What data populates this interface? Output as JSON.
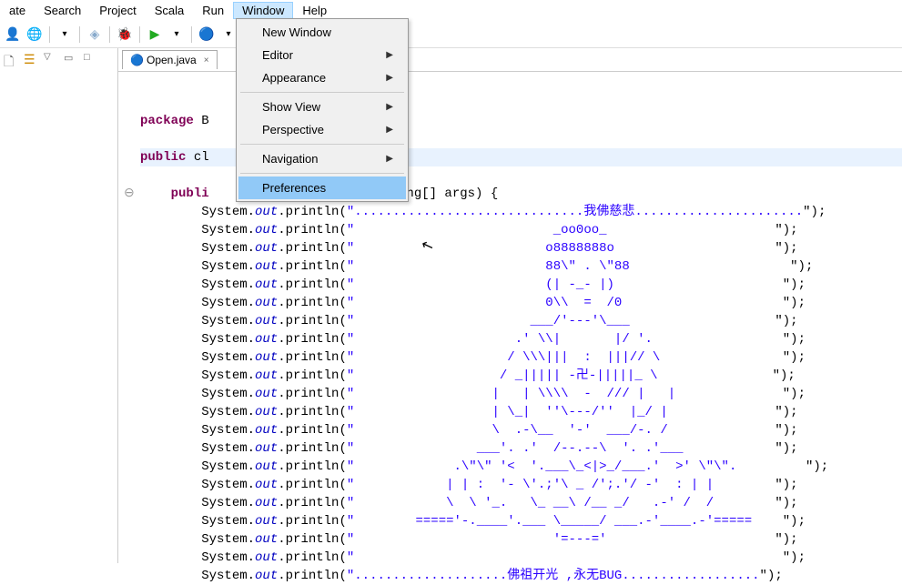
{
  "menubar": {
    "items": [
      "ate",
      "Search",
      "Project",
      "Scala",
      "Run",
      "Window",
      "Help"
    ],
    "active": "Window"
  },
  "dropdown": {
    "items": [
      {
        "label": "New Window",
        "arrow": false
      },
      {
        "label": "Editor",
        "arrow": true
      },
      {
        "label": "Appearance",
        "arrow": true
      },
      {
        "sep": true
      },
      {
        "label": "Show View",
        "arrow": true
      },
      {
        "label": "Perspective",
        "arrow": true
      },
      {
        "sep": true
      },
      {
        "label": "Navigation",
        "arrow": true
      },
      {
        "sep": true
      },
      {
        "label": "Preferences",
        "arrow": false,
        "highlighted": true
      }
    ]
  },
  "tab": {
    "filename": "Open.java",
    "close": "×"
  },
  "code": {
    "lines": [
      {
        "prefix": "",
        "kw": "package",
        "rest": " B"
      },
      {
        "blank": true
      },
      {
        "prefix": "",
        "kw": "public",
        "rest": " cl",
        "highlight": true
      },
      {
        "blank": true
      },
      {
        "prefix": "    ",
        "kw": "publi",
        "rest": "",
        "suffix": "ring[] args) {"
      }
    ],
    "println_lines": [
      "..............................我佛慈悲......................\");",
      "                          _oo0oo_                      \");",
      "                         o8888888o                     \");",
      "                         88\\\" . \\\"88                     \");",
      "                         (| -_- |)                      \");",
      "                         0\\\\  =  /0                     \");",
      "                       ___/'---'\\___                   \");",
      "                     .' \\\\|       |/ '.                 \");",
      "                    / \\\\\\|||  :  |||// \\                \");",
      "                   / _||||| -卍-|||||_ \\               \");",
      "                  |   | \\\\\\\\  -  /// |   |              \");",
      "                  | \\_|  ''\\---/''  |_/ |              \");",
      "                  \\  .-\\__  '-'  ___/-. /              \");",
      "                ___'. .'  /--.--\\  '. .'___            \");",
      "             .\\\"\\\" '<  '.___\\_<|>_/___.'  >' \\\"\\\".         \");",
      "            | | :  '- \\'.;'\\ _ /';.'/ -'  : | |        \");",
      "            \\  \\ '_.   \\_ __\\ /__ _/   .-' /  /        \");",
      "        ====='-.____'.___ \\_____/ ___.-'____.-'=====    \");",
      "                          '=---='                      \");",
      "                                                        \");",
      "....................佛祖开光 ,永无BUG..................\");"
    ],
    "println_prefix": "System.",
    "println_out": "out",
    "println_method": ".println(",
    "println_quote": "\"",
    "indent": "        "
  }
}
